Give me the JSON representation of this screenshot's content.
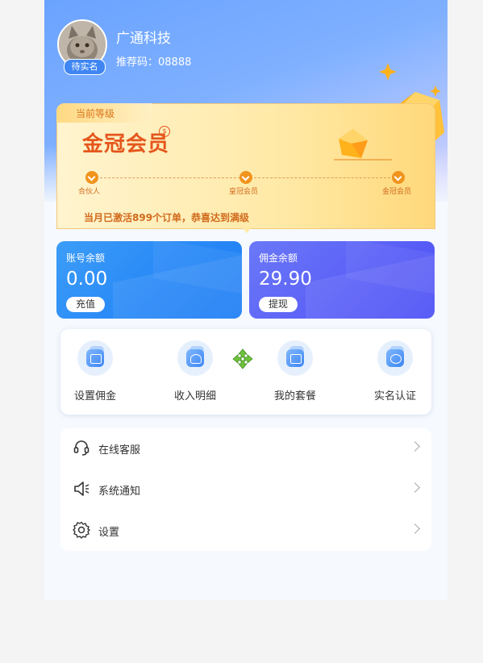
{
  "profile": {
    "company_name": "广通科技",
    "verification_badge": "待实名",
    "referral_code": "推荐码：08888"
  },
  "level_card": {
    "tab_label": "当前等级",
    "level_title": "金冠会员",
    "milestones": [
      "合伙人",
      "皇冠会员",
      "金冠会员"
    ],
    "progress_text": "当月已激活899个订单，恭喜达到满级"
  },
  "balances": {
    "account": {
      "label": "账号余额",
      "value": "0.00",
      "button": "充值"
    },
    "commission": {
      "label": "佣金余额",
      "value": "29.90",
      "button": "提现"
    }
  },
  "quick_actions": [
    {
      "label": "设置佣金",
      "icon": "wallet-icon"
    },
    {
      "label": "收入明细",
      "icon": "money-bag-icon"
    },
    {
      "label": "我的套餐",
      "icon": "shopping-bag-icon"
    },
    {
      "label": "实名认证",
      "icon": "id-card-icon"
    }
  ],
  "menu": [
    {
      "label": "在线客服",
      "icon": "headset-icon"
    },
    {
      "label": "系统通知",
      "icon": "speaker-icon"
    },
    {
      "label": "设置",
      "icon": "gear-icon"
    }
  ],
  "colors": {
    "header_gradient_start": "#6aa3ff",
    "level_accent": "#e5561c",
    "account_card": "#2a8af7",
    "commission_card": "#5d63f7",
    "move_icon": "#6fc43a"
  }
}
